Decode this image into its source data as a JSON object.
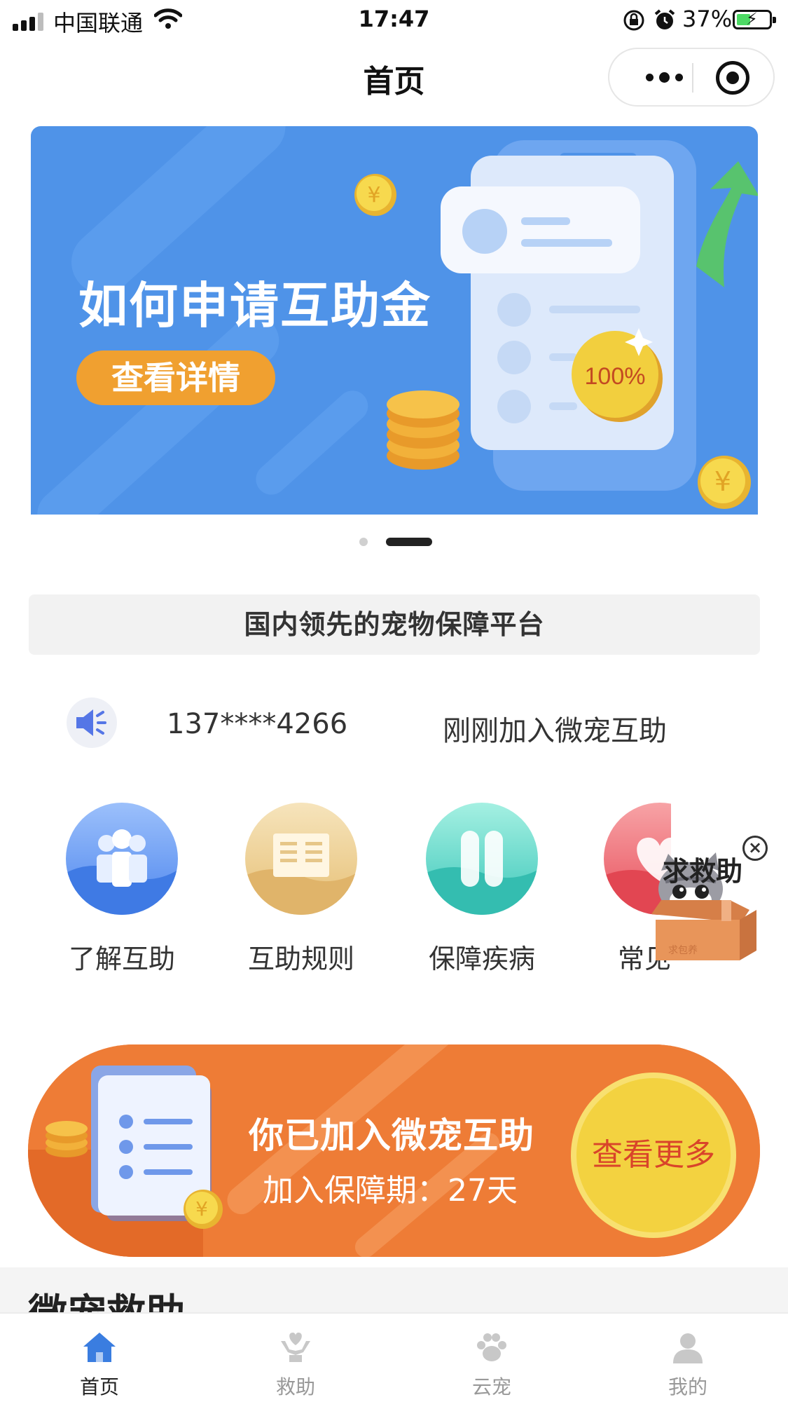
{
  "status_bar": {
    "carrier": "中国联通",
    "time": "17:47",
    "battery": "37%"
  },
  "nav": {
    "title": "首页"
  },
  "banner": {
    "title": "如何申请互助金",
    "button": "查看详情",
    "coin_symbol": "¥",
    "badge": "100%",
    "pages": 2,
    "active_page": 2
  },
  "slogan": "国内领先的宠物保障平台",
  "notice": {
    "phone": "137****4266",
    "text": "刚刚加入微宠互助"
  },
  "entries": [
    {
      "label": "了解互助"
    },
    {
      "label": "互助规则"
    },
    {
      "label": "保障疾病"
    },
    {
      "label": "常见问题"
    }
  ],
  "float_help": {
    "label": "求救助",
    "box_text": "求包养"
  },
  "member_card": {
    "title": "你已加入微宠互助",
    "subtitle": "加入保障期：27天",
    "button": "查看更多"
  },
  "section": {
    "title": "微宠救助"
  },
  "tabs": [
    {
      "label": "首页",
      "active": true
    },
    {
      "label": "救助",
      "active": false
    },
    {
      "label": "云宠",
      "active": false
    },
    {
      "label": "我的",
      "active": false
    }
  ],
  "colors": {
    "banner_blue": "#4f93e8",
    "orange": "#ee7c36",
    "gold": "#f3d240",
    "tab_active": "#3a7de0"
  }
}
